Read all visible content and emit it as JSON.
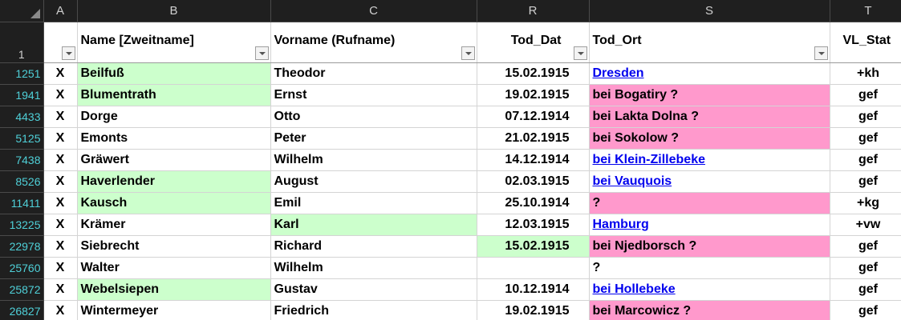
{
  "columns": {
    "select_all": "",
    "letters": [
      "A",
      "B",
      "C",
      "R",
      "S",
      "T"
    ]
  },
  "header_row": {
    "row_number": "1",
    "a": "",
    "b": "Name [Zweitname]",
    "c": "Vorname (Rufname)",
    "r": "Tod_Dat",
    "s": "Tod_Ort",
    "t": "VL_Stat"
  },
  "colors": {
    "green_fill": "#ccffcc",
    "pink_fill": "#ff99cc",
    "link": "#0000ee",
    "row_number_text": "#4fd0d8"
  },
  "rows": [
    {
      "num": "1251",
      "a": "X",
      "name": "Beilfuß",
      "first": "Theodor",
      "date": "15.02.1915",
      "place": "Dresden",
      "stat": "+kh",
      "name_green": true,
      "first_green": false,
      "date_green": false,
      "place_link": true,
      "place_pink": false
    },
    {
      "num": "1941",
      "a": "X",
      "name": "Blumentrath",
      "first": "Ernst",
      "date": "19.02.1915",
      "place": "bei Bogatiry ?",
      "stat": "gef",
      "name_green": true,
      "first_green": false,
      "date_green": false,
      "place_link": false,
      "place_pink": true
    },
    {
      "num": "4433",
      "a": "X",
      "name": "Dorge",
      "first": "Otto",
      "date": "07.12.1914",
      "place": "bei Lakta Dolna ?",
      "stat": "gef",
      "name_green": false,
      "first_green": false,
      "date_green": false,
      "place_link": false,
      "place_pink": true
    },
    {
      "num": "5125",
      "a": "X",
      "name": "Emonts",
      "first": "Peter",
      "date": "21.02.1915",
      "place": "bei Sokolow ?",
      "stat": "gef",
      "name_green": false,
      "first_green": false,
      "date_green": false,
      "place_link": false,
      "place_pink": true
    },
    {
      "num": "7438",
      "a": "X",
      "name": "Gräwert",
      "first": "Wilhelm",
      "date": "14.12.1914",
      "place": "bei Klein-Zillebeke",
      "stat": "gef",
      "name_green": false,
      "first_green": false,
      "date_green": false,
      "place_link": true,
      "place_pink": false
    },
    {
      "num": "8526",
      "a": "X",
      "name": "Haverlender",
      "first": "August",
      "date": "02.03.1915",
      "place": "bei Vauquois",
      "stat": "gef",
      "name_green": true,
      "first_green": false,
      "date_green": false,
      "place_link": true,
      "place_pink": false
    },
    {
      "num": "11411",
      "a": "X",
      "name": "Kausch",
      "first": "Emil",
      "date": "25.10.1914",
      "place": "?",
      "stat": "+kg",
      "name_green": true,
      "first_green": false,
      "date_green": false,
      "place_link": false,
      "place_pink": true
    },
    {
      "num": "13225",
      "a": "X",
      "name": "Krämer",
      "first": "Karl",
      "date": "12.03.1915",
      "place": "Hamburg",
      "stat": "+vw",
      "name_green": false,
      "first_green": true,
      "date_green": false,
      "place_link": true,
      "place_pink": false
    },
    {
      "num": "22978",
      "a": "X",
      "name": "Siebrecht",
      "first": "Richard",
      "date": "15.02.1915",
      "place": "bei Njedborsch ?",
      "stat": "gef",
      "name_green": false,
      "first_green": false,
      "date_green": true,
      "place_link": false,
      "place_pink": true
    },
    {
      "num": "25760",
      "a": "X",
      "name": "Walter",
      "first": "Wilhelm",
      "date": "",
      "place": "?",
      "stat": "gef",
      "name_green": false,
      "first_green": false,
      "date_green": false,
      "place_link": false,
      "place_pink": false
    },
    {
      "num": "25872",
      "a": "X",
      "name": "Webelsiepen",
      "first": "Gustav",
      "date": "10.12.1914",
      "place": "bei Hollebeke",
      "stat": "gef",
      "name_green": true,
      "first_green": false,
      "date_green": false,
      "place_link": true,
      "place_pink": false
    },
    {
      "num": "26827",
      "a": "X",
      "name": "Wintermeyer",
      "first": "Friedrich",
      "date": "19.02.1915",
      "place": "bei Marcowicz ?",
      "stat": "gef",
      "name_green": false,
      "first_green": false,
      "date_green": false,
      "place_link": false,
      "place_pink": true
    }
  ]
}
